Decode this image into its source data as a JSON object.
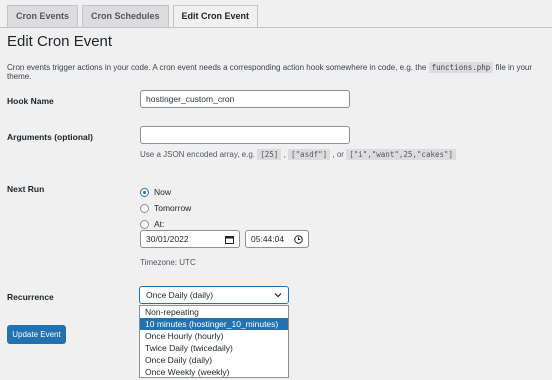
{
  "tabs": [
    "Cron Events",
    "Cron Schedules",
    "Edit Cron Event"
  ],
  "page_title": "Edit Cron Event",
  "intro": {
    "before": "Cron events trigger actions in your code. A cron event needs a corresponding action hook somewhere in code, e.g. the",
    "code": "functions.php",
    "after": "file in your theme."
  },
  "hook_name": {
    "label": "Hook Name",
    "value": "hostinger_custom_cron"
  },
  "arguments": {
    "label": "Arguments (optional)",
    "value": "",
    "desc_before": "Use a JSON encoded array, e.g.",
    "ex1": "[25]",
    "sep1": ",",
    "ex2": "[\"asdf\"]",
    "sep2": ", or",
    "ex3": "[\"i\",\"want\",25,\"cakes\"]"
  },
  "next_run": {
    "label": "Next Run",
    "options": [
      "Now",
      "Tomorrow",
      "At:"
    ],
    "selected": "Now",
    "date": "30/01/2022",
    "time": "05:44:04",
    "timezone": "Timezone: UTC"
  },
  "recurrence": {
    "label": "Recurrence",
    "selected": "Once Daily (daily)",
    "options": [
      "Non-repeating",
      "10 minutes (hostinger_10_minutes)",
      "Once Hourly (hourly)",
      "Twice Daily (twicedaily)",
      "Once Daily (daily)",
      "Once Weekly (weekly)"
    ],
    "highlighted": "10 minutes (hostinger_10_minutes)"
  },
  "submit_label": "Update Event",
  "icons": {
    "calendar": "calendar-icon",
    "clock": "clock-icon",
    "chevron": "chevron-down-icon"
  },
  "colors": {
    "accent": "#2271b1",
    "background": "#f0f0f1"
  }
}
